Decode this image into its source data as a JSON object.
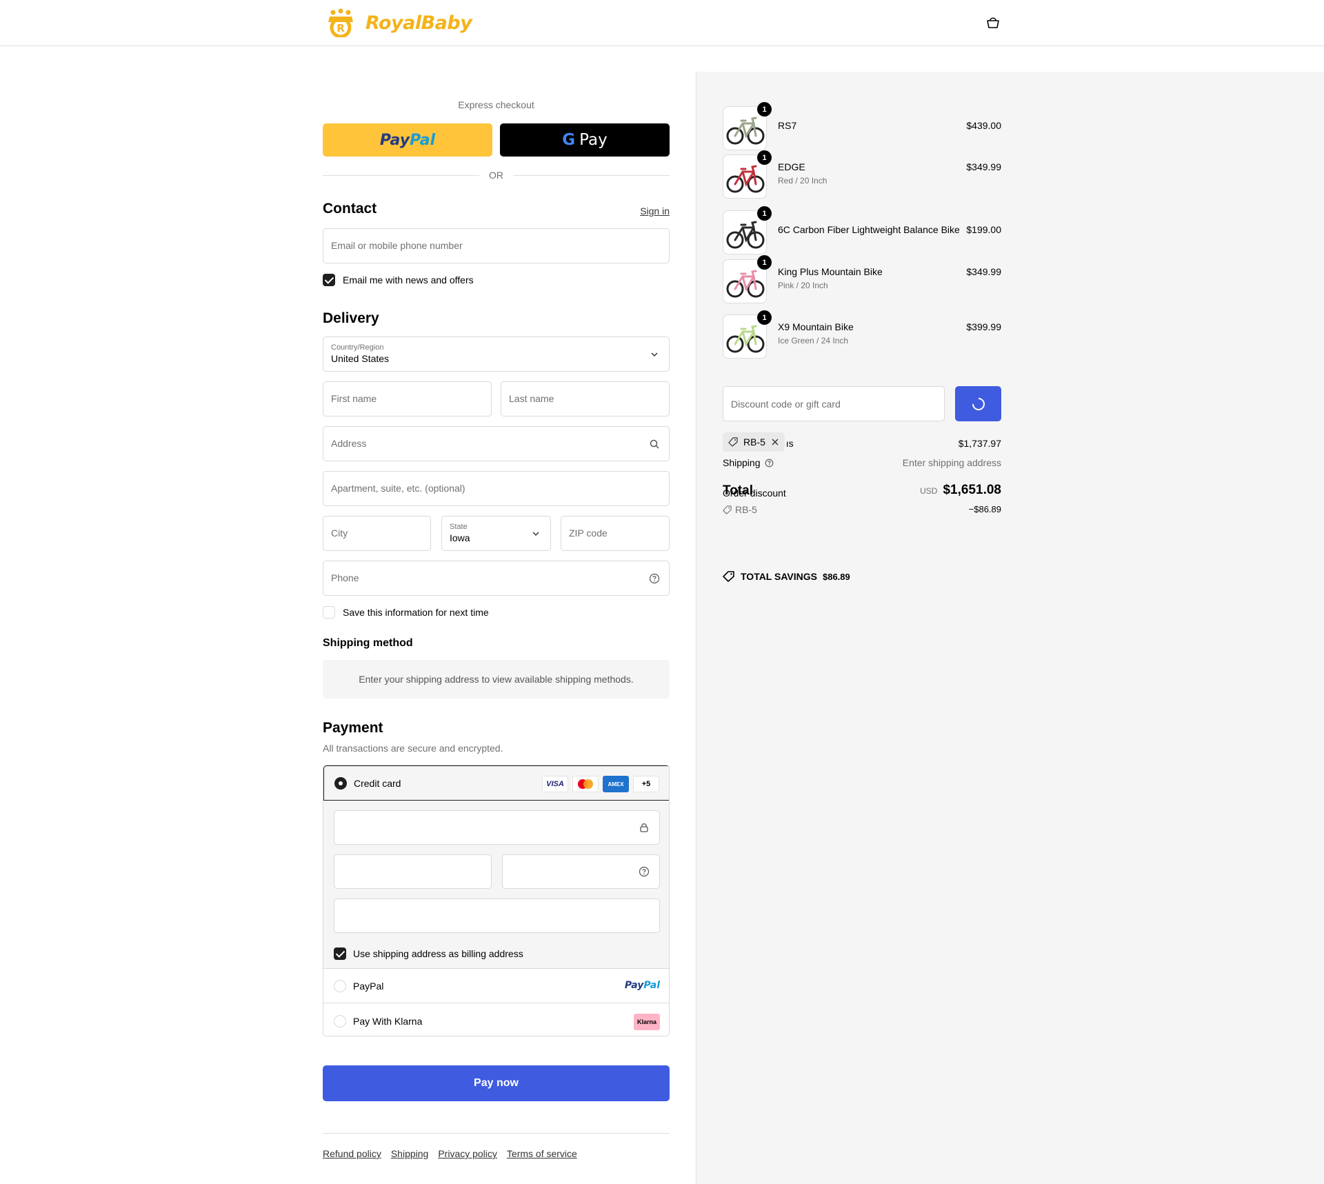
{
  "brand": {
    "name": "RoyalBaby",
    "color": "#f3b31a"
  },
  "header": {
    "cart_icon": "cart-icon"
  },
  "express": {
    "label": "Express checkout",
    "paypal_part1": "Pay",
    "paypal_part2": "Pal",
    "gpay_g": "G",
    "gpay_label": "Pay",
    "or_label": "OR"
  },
  "contact": {
    "title": "Contact",
    "sign_in": "Sign in",
    "email_placeholder": "Email or mobile phone number",
    "news_checkbox_label": "Email me with news and offers",
    "news_checked": true
  },
  "delivery": {
    "title": "Delivery",
    "country_label": "Country/Region",
    "country_value": "United States",
    "first_name_placeholder": "First name",
    "last_name_placeholder": "Last name",
    "address_placeholder": "Address",
    "apartment_placeholder": "Apartment, suite, etc. (optional)",
    "city_placeholder": "City",
    "state_label": "State",
    "state_value": "Iowa",
    "zip_placeholder": "ZIP code",
    "phone_placeholder": "Phone",
    "save_info_label": "Save this information for next time",
    "save_info_checked": false
  },
  "shipping_method": {
    "title": "Shipping method",
    "message": "Enter your shipping address to view available shipping methods."
  },
  "payment": {
    "title": "Payment",
    "subtitle": "All transactions are secure and encrypted.",
    "credit_card_label": "Credit card",
    "card_badges": {
      "visa": "VISA",
      "amex": "AMEX",
      "more": "+5"
    },
    "billing_checkbox_label": "Use shipping address as billing address",
    "billing_checked": true,
    "paypal_option_label": "PayPal",
    "paypal_logo_part1": "Pay",
    "paypal_logo_part2": "Pal",
    "klarna_option_label": "Pay With Klarna",
    "klarna_logo": "Klarna"
  },
  "pay_now_label": "Pay now",
  "footer": {
    "links": [
      "Refund policy",
      "Shipping",
      "Privacy policy",
      "Terms of service"
    ]
  },
  "cart": {
    "items": [
      {
        "name": "RS7",
        "variant": "",
        "price": "$439.00",
        "qty": "1",
        "frame_color": "#9aa58a"
      },
      {
        "name": "EDGE",
        "variant": "Red / 20 Inch",
        "price": "$349.99",
        "qty": "1",
        "frame_color": "#c2303c"
      },
      {
        "name": "6C Carbon Fiber Lightweight Balance Bike",
        "variant": "",
        "price": "$199.00",
        "qty": "1",
        "frame_color": "#2b2b2b"
      },
      {
        "name": "King Plus Mountain Bike",
        "variant": "Pink / 20 Inch",
        "price": "$349.99",
        "qty": "1",
        "frame_color": "#e88ea6"
      },
      {
        "name": "X9 Mountain Bike",
        "variant": "Ice Green / 24 Inch",
        "price": "$399.99",
        "qty": "1",
        "frame_color": "#b9d98a"
      }
    ],
    "discount_placeholder": "Discount code or gift card",
    "applied_code": "RB-5",
    "subtotal_label_tail": "ıs",
    "subtotal_value": "$1,737.97",
    "shipping_label": "Shipping",
    "shipping_value": "Enter shipping address",
    "total_label": "Total",
    "order_discount_label": "Order discount",
    "total_currency": "USD",
    "total_value": "$1,651.08",
    "discount_code": "RB-5",
    "discount_value": "−$86.89",
    "savings_label": "TOTAL SAVINGS",
    "savings_value": "$86.89"
  },
  "colors": {
    "accent": "#3f5ce0",
    "paypal_yellow": "#ffc439",
    "summary_bg": "#f5f5f5"
  }
}
